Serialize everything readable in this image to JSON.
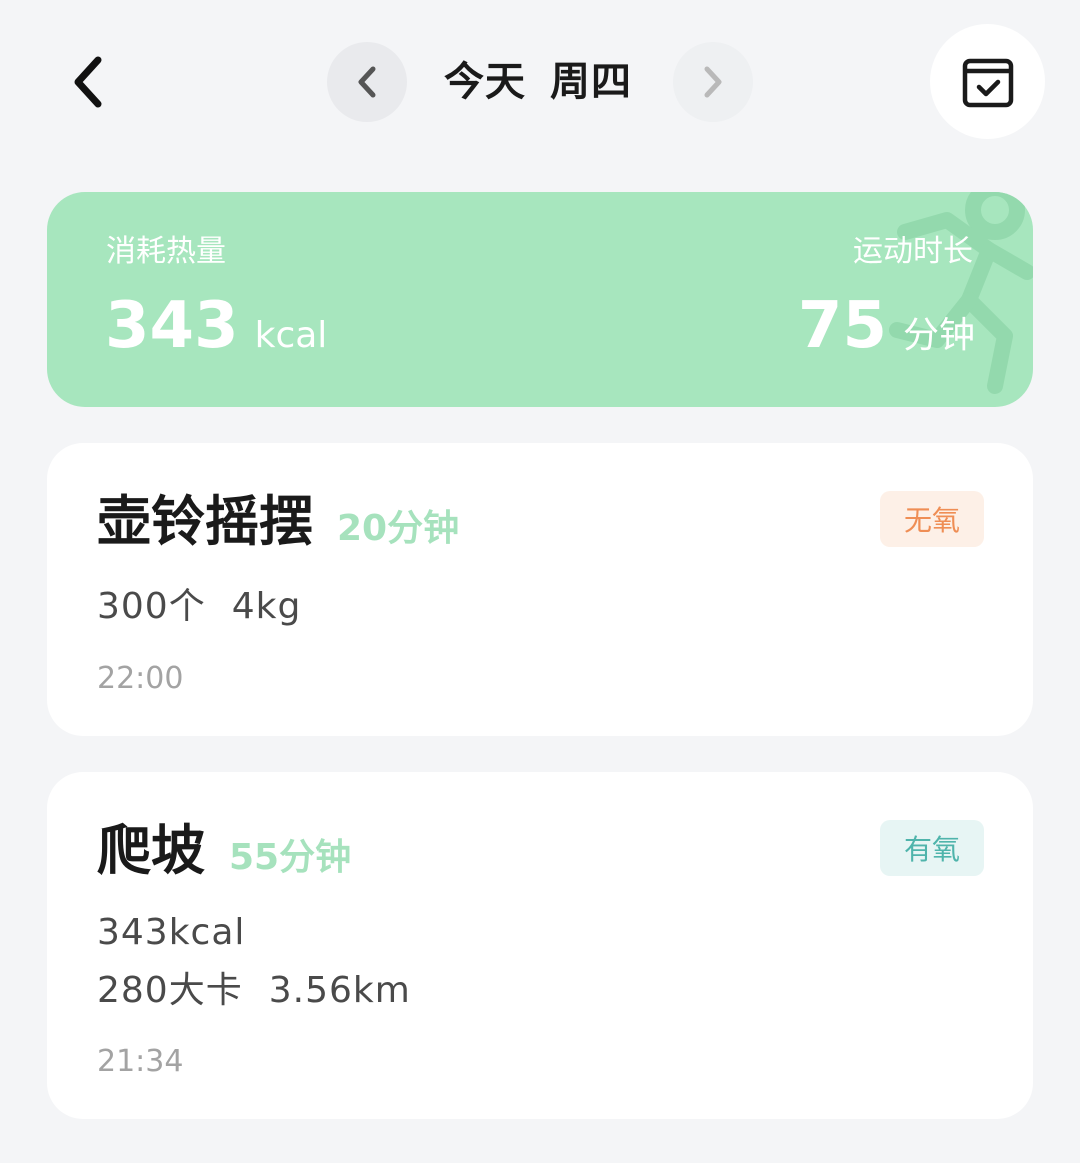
{
  "header": {
    "title_day": "今天",
    "title_weekday": "周四",
    "icons": {
      "back": "chevron-left-icon",
      "prev": "chevron-left-icon",
      "next": "chevron-right-icon",
      "calendar": "calendar-check-icon"
    }
  },
  "summary": {
    "calories_label": "消耗热量",
    "calories_value": "343",
    "calories_unit": "kcal",
    "duration_label": "运动时长",
    "duration_value": "75",
    "duration_unit": "分钟",
    "background_color": "#a7e6be",
    "decoration_icon": "running-person-icon"
  },
  "activities": [
    {
      "name": "壶铃摇摆",
      "duration": "20分钟",
      "tag": "无氧",
      "details": [
        "300个",
        "4kg"
      ],
      "time": "22:00"
    },
    {
      "name": "爬坡",
      "duration": "55分钟",
      "tag": "有氧",
      "details_line1": "343kcal",
      "details_line2": [
        "280大卡",
        "3.56km"
      ],
      "time": "21:34"
    }
  ],
  "colors": {
    "accent_green": "#a6e2bd",
    "anaerobic_tag": "#ef8e55",
    "aerobic_tag": "#4fb4ab"
  }
}
